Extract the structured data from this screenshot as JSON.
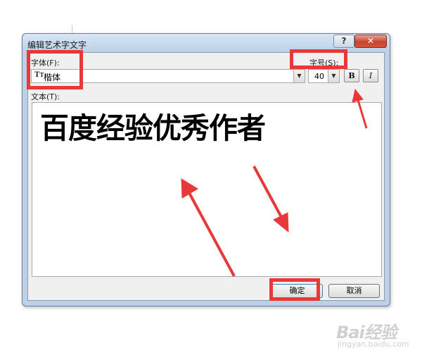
{
  "dialog": {
    "title": "编辑艺术字文字",
    "help_label": "?",
    "close_label": "✕"
  },
  "font": {
    "label": "字体(F):",
    "value": "楷体",
    "icon": "truetype-icon"
  },
  "size": {
    "label": "字号(S):",
    "value": "40"
  },
  "style_buttons": {
    "bold_label": "B",
    "italic_label": "I"
  },
  "text": {
    "label": "文本(T):",
    "value": "百度经验优秀作者"
  },
  "buttons": {
    "ok_label": "确定",
    "cancel_label": "取消"
  },
  "annotations": {
    "highlight_color": "#e8393a",
    "arrow_color": "#e8393a"
  },
  "watermark": {
    "main": "Bai经验",
    "sub": "jingyan.baidu.com"
  }
}
